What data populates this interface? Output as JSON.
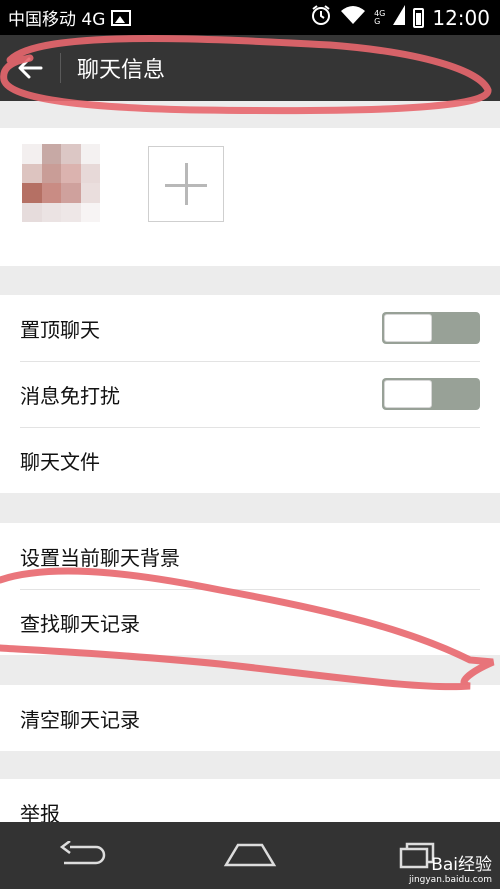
{
  "status_bar": {
    "carrier": "中国移动 4G",
    "net_small_top": "4G",
    "net_small_bottom": "G",
    "time": "12:00"
  },
  "header": {
    "back_icon": "arrow-left-icon",
    "title": "聊天信息"
  },
  "members": {
    "add_icon": "plus-icon"
  },
  "settings": {
    "group1": [
      {
        "label": "置顶聊天",
        "toggle": false
      },
      {
        "label": "消息免打扰",
        "toggle": false
      },
      {
        "label": "聊天文件"
      }
    ],
    "group2": [
      {
        "label": "设置当前聊天背景"
      },
      {
        "label": "查找聊天记录"
      }
    ],
    "group3": [
      {
        "label": "清空聊天记录"
      }
    ],
    "group4": [
      {
        "label": "举报"
      }
    ]
  },
  "nav_bar": {
    "back_icon": "nav-back-icon",
    "home_icon": "nav-home-icon",
    "recents_icon": "nav-recents-icon"
  },
  "watermark": {
    "brand": "Bai经验",
    "url": "jingyan.baidu.com"
  },
  "colors": {
    "title_bar": "#353535",
    "toggle_track": "#98a197",
    "annotation": "#e8676e"
  }
}
